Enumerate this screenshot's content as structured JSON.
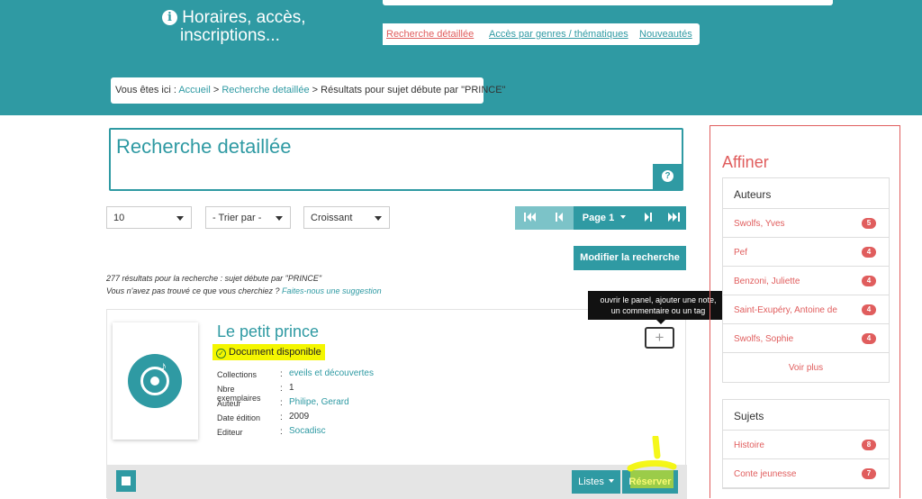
{
  "header": {
    "info_line1": "Horaires, accès,",
    "info_line2": "inscriptions...",
    "subnav": [
      "Recherche détaillée",
      "Accès par genres / thématiques",
      "Nouveautés"
    ],
    "breadcrumb_prefix": "Vous êtes ici :",
    "breadcrumb_home": "Accueil",
    "breadcrumb_sep": ">",
    "breadcrumb_search": "Recherche detaillée",
    "breadcrumb_current": "Résultats pour sujet débute par \"PRINCE\""
  },
  "search": {
    "title": "Recherche detaillée",
    "help_icon": "?"
  },
  "controls": {
    "per_page": "10",
    "sort": "- Trier par -",
    "order": "Croissant",
    "page_label": "Page 1",
    "modify_button": "Modifier la recherche"
  },
  "results": {
    "count_text": "277 résultats pour la recherche : sujet débute par \"PRINCE\"",
    "not_found_text": "Vous n'avez pas trouvé ce que vous cherchiez ?",
    "suggest_link": "Faites-nous une suggestion"
  },
  "tooltip": {
    "line1": "ouvrir le panel, ajouter une note,",
    "line2": "un commentaire ou un tag"
  },
  "item": {
    "title": "Le petit prince",
    "availability": "Document disponible",
    "fields": [
      {
        "label": "Collections",
        "value": "eveils et découvertes",
        "link": true
      },
      {
        "label": "Nbre exemplaires",
        "value": "1",
        "link": false
      },
      {
        "label": "Auteur",
        "value": "Philipe, Gerard",
        "link": true
      },
      {
        "label": "Date édition",
        "value": "2009",
        "link": false
      },
      {
        "label": "Editeur",
        "value": "Socadisc",
        "link": true
      }
    ],
    "separator": ":",
    "add_icon": "+",
    "listes_button": "Listes",
    "reserve_button": "Réserver"
  },
  "sidebar": {
    "title": "Affiner",
    "authors_title": "Auteurs",
    "authors": [
      {
        "name": "Swolfs, Yves",
        "count": "5"
      },
      {
        "name": "Pef",
        "count": "4"
      },
      {
        "name": "Benzoni, Juliette",
        "count": "4"
      },
      {
        "name": "Saint-Exupéry, Antoine de",
        "count": "4"
      },
      {
        "name": "Swolfs, Sophie",
        "count": "4"
      }
    ],
    "see_more": "Voir plus",
    "subjects_title": "Sujets",
    "subjects": [
      {
        "name": "Histoire",
        "count": "8"
      },
      {
        "name": "Conte jeunesse",
        "count": "7"
      }
    ]
  },
  "colors": {
    "brand": "#2f9aa3",
    "accent": "#e05d5d",
    "highlight": "#f4f600"
  }
}
